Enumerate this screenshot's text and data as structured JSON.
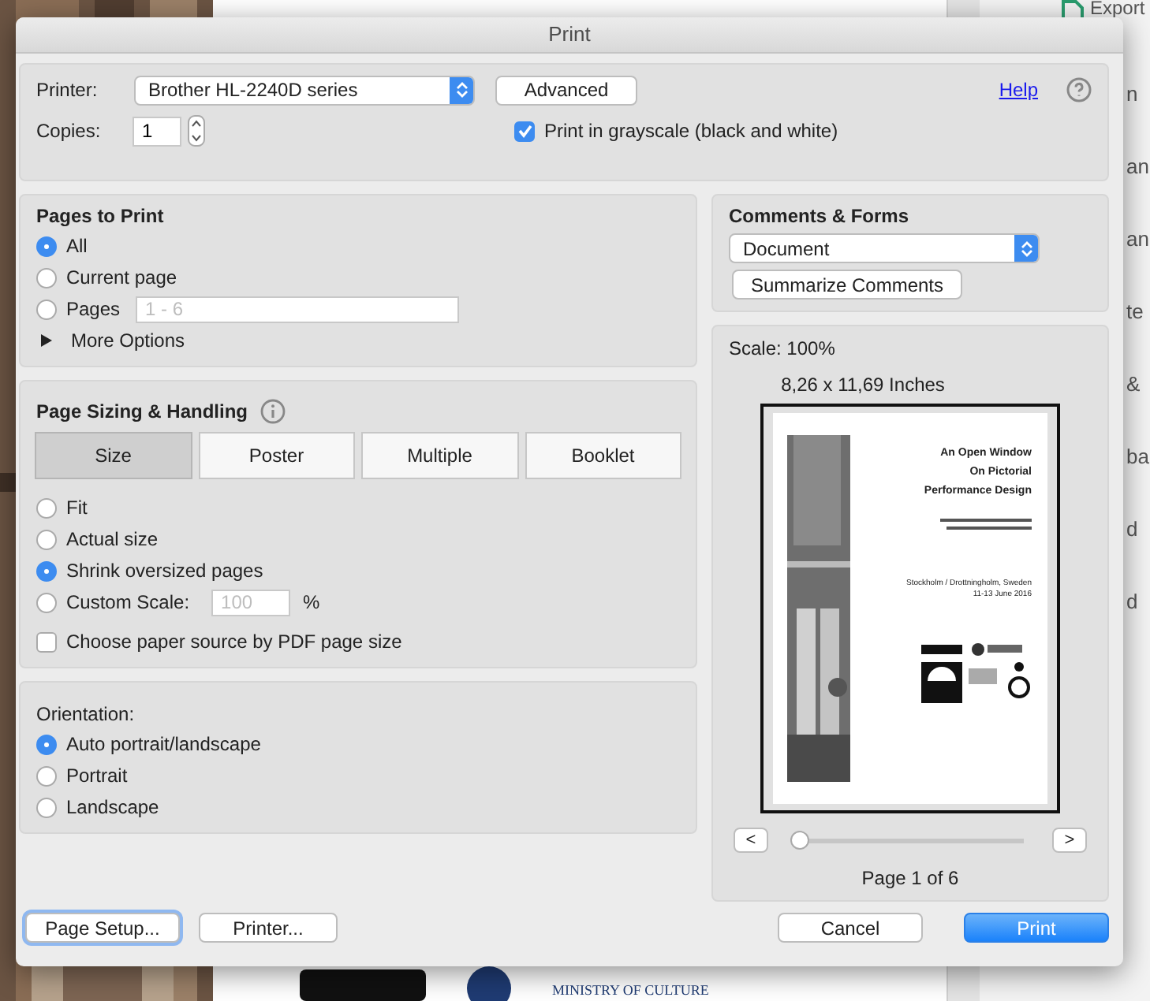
{
  "backdrop": {
    "sidebar_items": [
      "Export",
      "n",
      "an",
      "an",
      "te",
      "&",
      "ba",
      "d",
      "d"
    ],
    "footer_text": "MINISTRY OF CULTURE"
  },
  "window": {
    "title": "Print"
  },
  "printer": {
    "label": "Printer:",
    "value": "Brother HL-2240D series"
  },
  "advanced_button": "Advanced",
  "help_link": "Help",
  "copies": {
    "label": "Copies:",
    "value": "1"
  },
  "grayscale": {
    "label": "Print in grayscale (black and white)",
    "checked": true
  },
  "pages_to_print": {
    "title": "Pages to Print",
    "options": [
      {
        "label": "All",
        "selected": true
      },
      {
        "label": "Current page",
        "selected": false
      },
      {
        "label": "Pages",
        "selected": false,
        "placeholder": "1 - 6"
      }
    ],
    "more_options": {
      "label": "More Options",
      "expanded": false
    }
  },
  "page_sizing": {
    "title": "Page Sizing & Handling",
    "tabs": [
      {
        "label": "Size",
        "selected": true
      },
      {
        "label": "Poster",
        "selected": false
      },
      {
        "label": "Multiple",
        "selected": false
      },
      {
        "label": "Booklet",
        "selected": false
      }
    ],
    "options": [
      {
        "label": "Fit",
        "selected": false
      },
      {
        "label": "Actual size",
        "selected": false
      },
      {
        "label": "Shrink oversized pages",
        "selected": true
      },
      {
        "label": "Custom Scale:",
        "selected": false,
        "placeholder": "100",
        "unit": "%"
      }
    ],
    "paper_source": {
      "label": "Choose paper source by PDF page size",
      "checked": false
    }
  },
  "orientation": {
    "title": "Orientation:",
    "options": [
      {
        "label": "Auto portrait/landscape",
        "selected": true
      },
      {
        "label": "Portrait",
        "selected": false
      },
      {
        "label": "Landscape",
        "selected": false
      }
    ]
  },
  "comments_forms": {
    "title": "Comments & Forms",
    "value": "Document",
    "button": "Summarize Comments"
  },
  "preview": {
    "scale": "Scale: 100%",
    "size": "8,26 x 11,69 Inches",
    "page": {
      "title_lines": [
        "An Open Window",
        "On Pictorial",
        "Performance Design"
      ],
      "place": "Stockholm / Drottningholm, Sweden",
      "dates": "11-13 June 2016"
    },
    "prev": "<",
    "next": ">",
    "level": 0,
    "page_label": "Page 1 of 6"
  },
  "buttons": {
    "page_setup": "Page Setup...",
    "printer": "Printer...",
    "cancel": "Cancel",
    "print": "Print"
  }
}
